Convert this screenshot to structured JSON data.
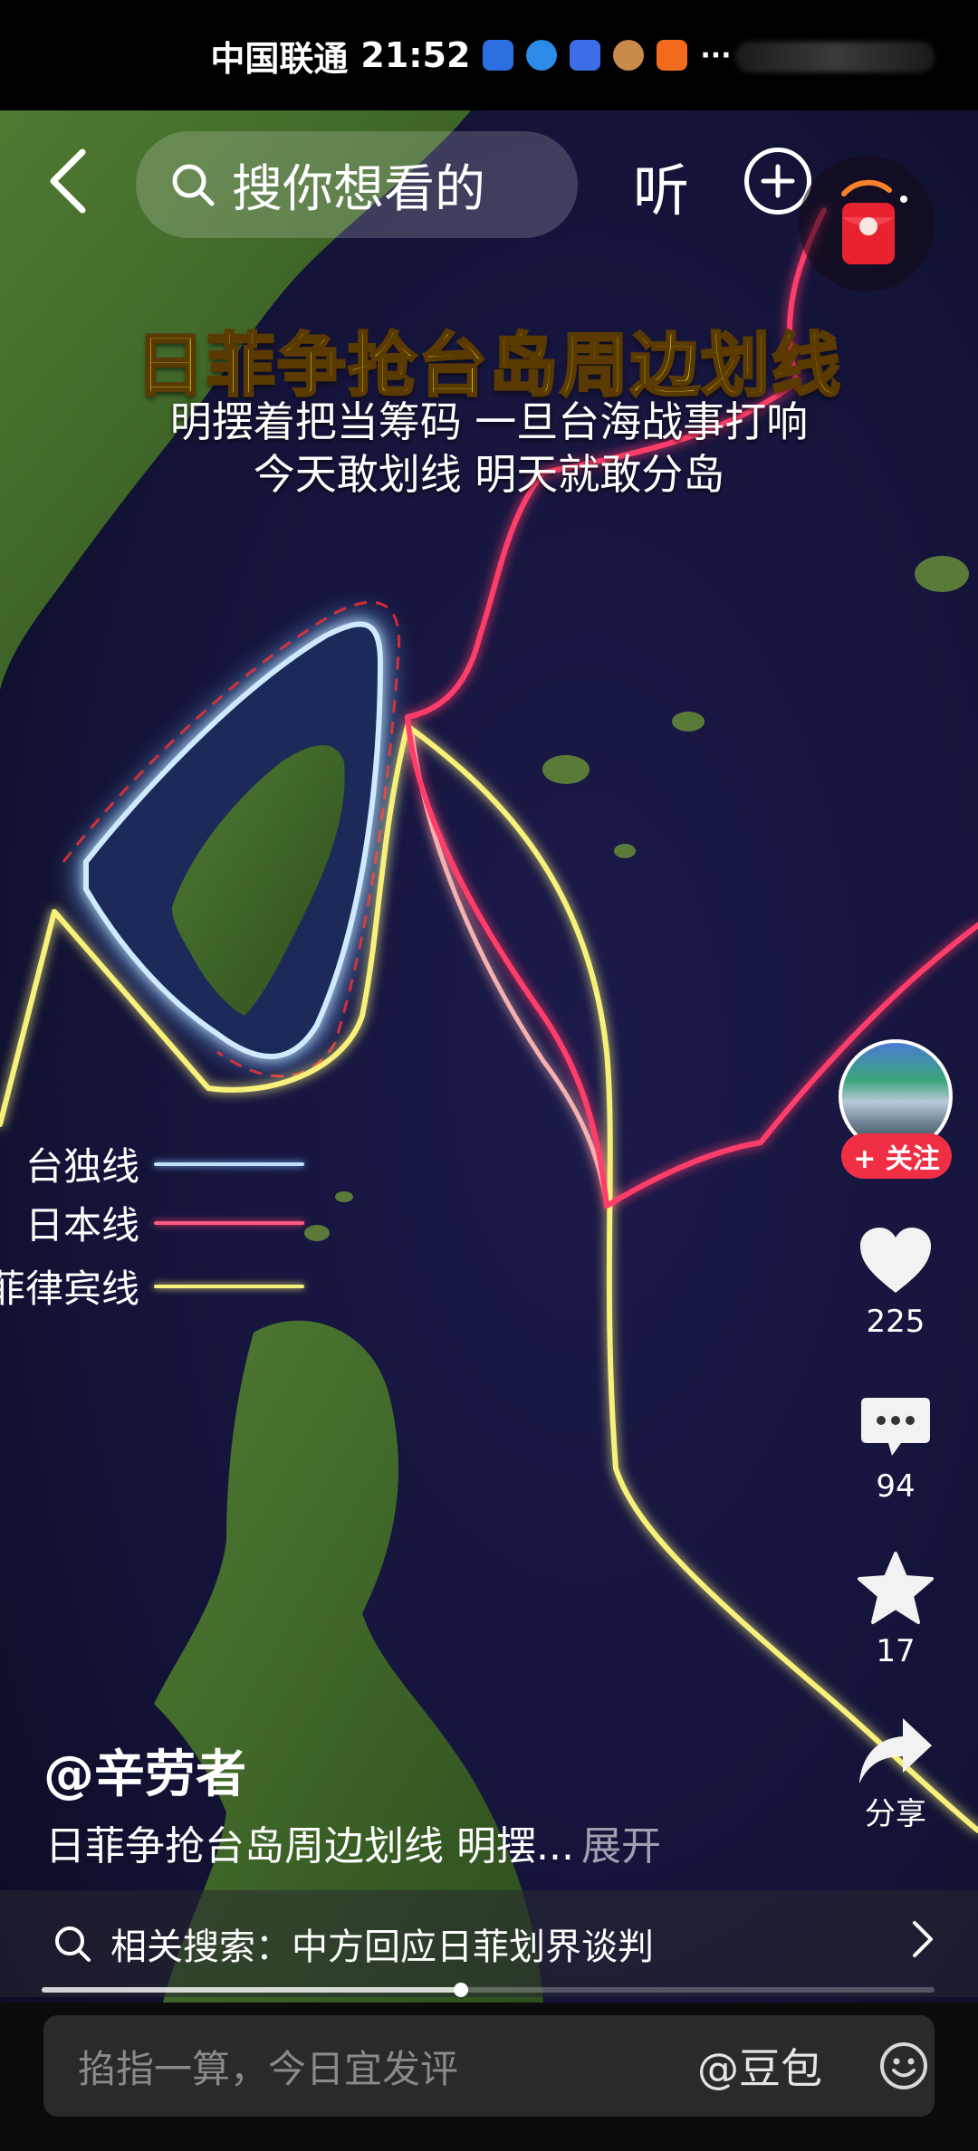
{
  "status_bar": {
    "carrier": "中国联通",
    "time": "21:52",
    "more_indicator": "···",
    "app_icons": [
      "blue-app-icon",
      "blue-circle-app-icon",
      "music-app-icon",
      "avatar-app-icon",
      "orange-app-icon"
    ]
  },
  "header": {
    "back_icon": "chevron-left-icon",
    "search_placeholder": "搜你想看的",
    "listen_label": "听",
    "add_icon": "plus-circle-icon",
    "widget_icon": "red-packet-icon"
  },
  "video": {
    "title": "日菲争抢台岛周边划线",
    "subtitle_line1": "明摆着把当筹码 一旦台海战事打响",
    "subtitle_line2": "今天敢划线 明天就敢分岛",
    "legend": [
      {
        "label": "台独线",
        "color": "#9fd4ff"
      },
      {
        "label": "日本线",
        "color": "#ff3d6a"
      },
      {
        "label": "菲律宾线",
        "color": "#f7f07a"
      }
    ]
  },
  "sidebar": {
    "follow_label": "+ 关注",
    "like_count": "225",
    "comment_count": "94",
    "favorite_count": "17",
    "share_label": "分享"
  },
  "info": {
    "author": "@辛劳者",
    "description": "日菲争抢台岛周边划线 明摆...",
    "expand_label": "展开"
  },
  "related_search": {
    "text": "相关搜索：中方回应日菲划界谈判"
  },
  "progress": {
    "fraction": 0.47
  },
  "comment_bar": {
    "placeholder": "掐指一算，今日宜发评",
    "mention_label": "@豆包"
  }
}
